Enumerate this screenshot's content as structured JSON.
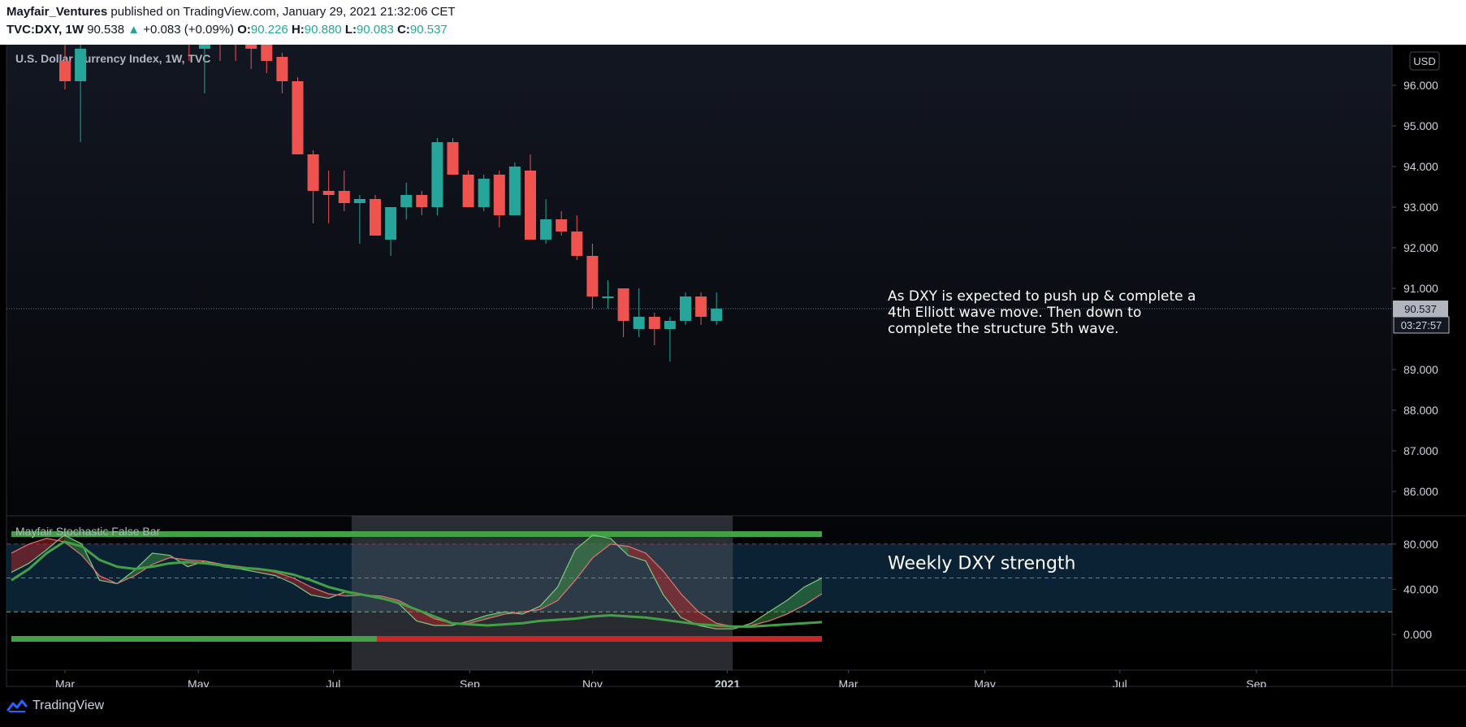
{
  "header": {
    "publisher": "Mayfair_Ventures",
    "published_text": "published on TradingView.com, January 29, 2021 21:32:06 CET",
    "symbol": "TVC:DXY, 1W",
    "last": "90.538",
    "change": "+0.083 (+0.09%)",
    "o_label": "O:",
    "o_value": "90.226",
    "h_label": "H:",
    "h_value": "90.880",
    "l_label": "L:",
    "l_value": "90.083",
    "c_label": "C:",
    "c_value": "90.537"
  },
  "colors": {
    "up": "#26a69a",
    "down": "#ef5350",
    "indicator_green": "#43a047",
    "indicator_red": "#c62828",
    "band_fill": "#0e2a40",
    "highlight": "#4a4f5a"
  },
  "chart_data": [
    {
      "type": "candlestick",
      "title": "U.S. Dollar Currency Index, 1W, TVC",
      "currency": "USD",
      "last_price_label": "90.537",
      "countdown_label": "03:27:57",
      "y_ticks": [
        "96.000",
        "95.000",
        "94.000",
        "93.000",
        "92.000",
        "91.000",
        "89.000",
        "88.000",
        "87.000",
        "86.000"
      ],
      "ylim": [
        85.4,
        97.0
      ],
      "x_ticks": [
        "Mar",
        "May",
        "Jul",
        "Sep",
        "Nov",
        "2021",
        "Mar",
        "May",
        "Jul",
        "Sep"
      ],
      "annotation": "As DXY is expected to push up & complete a\n4th Elliott wave move.  Then down to\ncomplete the structure 5th wave.",
      "candles": [
        {
          "week": 0,
          "o": 96.6,
          "h": 97.2,
          "l": 95.9,
          "c": 96.1
        },
        {
          "week": 1,
          "o": 96.1,
          "h": 97.2,
          "l": 94.6,
          "c": 96.9
        },
        {
          "week": 8,
          "o": 97.4,
          "h": 97.6,
          "l": 96.6,
          "c": 97.0
        },
        {
          "week": 9,
          "o": 96.9,
          "h": 97.0,
          "l": 95.8,
          "c": 97.1
        },
        {
          "week": 10,
          "o": 97.2,
          "h": 97.4,
          "l": 96.6,
          "c": 97.1
        },
        {
          "week": 11,
          "o": 97.1,
          "h": 97.3,
          "l": 96.6,
          "c": 97.0
        },
        {
          "week": 12,
          "o": 97.0,
          "h": 97.3,
          "l": 96.4,
          "c": 96.9
        },
        {
          "week": 13,
          "o": 97.0,
          "h": 97.3,
          "l": 96.3,
          "c": 96.6
        },
        {
          "week": 14,
          "o": 96.7,
          "h": 96.8,
          "l": 95.8,
          "c": 96.1
        },
        {
          "week": 15,
          "o": 96.1,
          "h": 96.2,
          "l": 94.3,
          "c": 94.3
        },
        {
          "week": 16,
          "o": 94.3,
          "h": 94.4,
          "l": 92.6,
          "c": 93.4
        },
        {
          "week": 17,
          "o": 93.4,
          "h": 93.9,
          "l": 92.6,
          "c": 93.3
        },
        {
          "week": 18,
          "o": 93.4,
          "h": 93.9,
          "l": 92.9,
          "c": 93.1
        },
        {
          "week": 19,
          "o": 93.1,
          "h": 93.3,
          "l": 92.1,
          "c": 93.2
        },
        {
          "week": 20,
          "o": 93.2,
          "h": 93.3,
          "l": 92.3,
          "c": 92.3
        },
        {
          "week": 21,
          "o": 92.2,
          "h": 93.0,
          "l": 91.8,
          "c": 93.0
        },
        {
          "week": 22,
          "o": 93.0,
          "h": 93.6,
          "l": 92.7,
          "c": 93.3
        },
        {
          "week": 23,
          "o": 93.3,
          "h": 93.4,
          "l": 92.8,
          "c": 93.0
        },
        {
          "week": 24,
          "o": 93.0,
          "h": 94.7,
          "l": 92.8,
          "c": 94.6
        },
        {
          "week": 25,
          "o": 94.6,
          "h": 94.7,
          "l": 93.8,
          "c": 93.8
        },
        {
          "week": 26,
          "o": 93.8,
          "h": 93.9,
          "l": 93.0,
          "c": 93.0
        },
        {
          "week": 27,
          "o": 93.0,
          "h": 93.8,
          "l": 92.9,
          "c": 93.7
        },
        {
          "week": 28,
          "o": 93.8,
          "h": 93.9,
          "l": 92.5,
          "c": 92.8
        },
        {
          "week": 29,
          "o": 92.8,
          "h": 94.1,
          "l": 92.8,
          "c": 94.0
        },
        {
          "week": 30,
          "o": 93.9,
          "h": 94.3,
          "l": 92.2,
          "c": 92.2
        },
        {
          "week": 31,
          "o": 92.2,
          "h": 93.2,
          "l": 92.1,
          "c": 92.7
        },
        {
          "week": 32,
          "o": 92.7,
          "h": 92.9,
          "l": 92.3,
          "c": 92.4
        },
        {
          "week": 33,
          "o": 92.4,
          "h": 92.8,
          "l": 91.7,
          "c": 91.8
        },
        {
          "week": 34,
          "o": 91.8,
          "h": 92.1,
          "l": 90.5,
          "c": 90.8
        },
        {
          "week": 35,
          "o": 90.8,
          "h": 91.2,
          "l": 90.5,
          "c": 90.8
        },
        {
          "week": 36,
          "o": 91.0,
          "h": 91.0,
          "l": 89.8,
          "c": 90.2
        },
        {
          "week": 37,
          "o": 90.0,
          "h": 91.0,
          "l": 89.8,
          "c": 90.3
        },
        {
          "week": 38,
          "o": 90.3,
          "h": 90.4,
          "l": 89.6,
          "c": 90.0
        },
        {
          "week": 39,
          "o": 90.0,
          "h": 90.3,
          "l": 89.2,
          "c": 90.2
        },
        {
          "week": 40,
          "o": 90.2,
          "h": 90.9,
          "l": 90.1,
          "c": 90.8
        },
        {
          "week": 41,
          "o": 90.8,
          "h": 90.9,
          "l": 90.1,
          "c": 90.3
        },
        {
          "week": 42,
          "o": 90.2,
          "h": 90.9,
          "l": 90.1,
          "c": 90.5
        }
      ]
    },
    {
      "type": "line",
      "title": "Mayfair Stochastic False Bar",
      "annotation": "Weekly DXY strength",
      "y_ticks": [
        "80.000",
        "40.000",
        "0.000"
      ],
      "ylim": [
        -15,
        105
      ],
      "levels": [
        80,
        50,
        20
      ],
      "band": [
        20,
        80
      ],
      "highlight_weeks": [
        19,
        42
      ],
      "series": [
        {
          "values": [
            55,
            63,
            75,
            88,
            80,
            48,
            45,
            57,
            72,
            70,
            60,
            65,
            60,
            58,
            55,
            52,
            45,
            35,
            32,
            38,
            35,
            32,
            27,
            12,
            8,
            8,
            12,
            17,
            20,
            18,
            25,
            42,
            75,
            88,
            85,
            70,
            65,
            35,
            15,
            8,
            5,
            5,
            10,
            20,
            30,
            42,
            50
          ]
        },
        {
          "values": [
            72,
            80,
            85,
            82,
            70,
            52,
            45,
            52,
            62,
            68,
            66,
            65,
            62,
            60,
            58,
            55,
            50,
            42,
            36,
            34,
            35,
            34,
            30,
            22,
            14,
            10,
            10,
            14,
            18,
            20,
            22,
            30,
            48,
            68,
            80,
            78,
            72,
            56,
            36,
            20,
            10,
            7,
            8,
            12,
            18,
            26,
            36
          ]
        },
        {
          "values": [
            48,
            58,
            72,
            82,
            78,
            66,
            60,
            58,
            60,
            63,
            64,
            63,
            61,
            59,
            58,
            56,
            53,
            48,
            42,
            38,
            35,
            32,
            28,
            22,
            16,
            10,
            9,
            8,
            9,
            10,
            12,
            13,
            14,
            16,
            17,
            16,
            15,
            13,
            11,
            9,
            8,
            7,
            7,
            8,
            9,
            10,
            11
          ]
        }
      ]
    }
  ],
  "footer": {
    "brand": "TradingView"
  }
}
